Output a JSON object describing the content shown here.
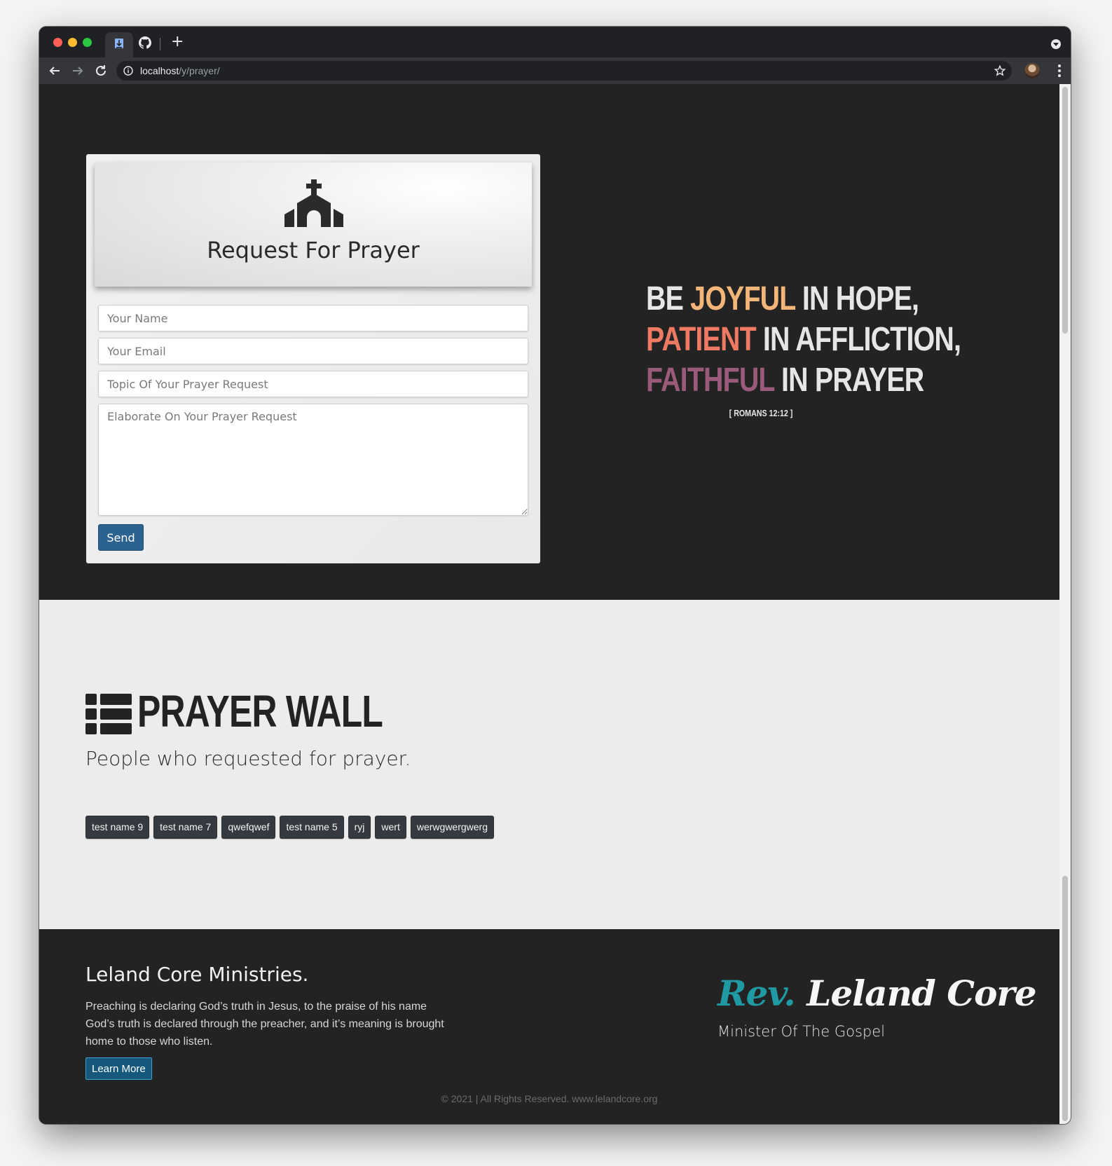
{
  "browser": {
    "url_host": "localhost",
    "url_path": "/y/prayer/",
    "new_tab_label": "+"
  },
  "form": {
    "title": "Request For Prayer",
    "name_placeholder": "Your Name",
    "email_placeholder": "Your Email",
    "topic_placeholder": "Topic Of Your Prayer Request",
    "message_placeholder": "Elaborate On Your Prayer Request",
    "send_label": "Send"
  },
  "verse": {
    "line1_pre": "BE ",
    "line1_hl": "JOYFUL",
    "line1_post": " IN HOPE,",
    "line2_hl": "PATIENT",
    "line2_post": " IN AFFLICTION,",
    "line3_hl": "FAITHFUL",
    "line3_post": " IN PRAYER",
    "reference": "[ ROMANS 12:12 ]",
    "colors": {
      "joyful": "#f4b579",
      "patient": "#ee7a64",
      "faithful": "#9a5b7a"
    }
  },
  "wall": {
    "title": "PRAYER WALL",
    "subtitle": "People who requested for prayer.",
    "names": [
      "test name 9",
      "test name 7",
      "qwefqwef",
      "test name 5",
      "ryj",
      "wert",
      "werwgwergwerg"
    ]
  },
  "footer": {
    "org_name": "Leland Core Ministries.",
    "description": "Preaching is declaring God’s truth in Jesus, to the praise of his name God’s truth is declared through the preacher, and it’s meaning is brought home to those who listen.",
    "learn_more_label": "Learn More",
    "signature_prefix": "Rev.",
    "signature_name": " Leland Core",
    "minister_title": "Minister Of The Gospel",
    "copyright": "© 2021 | All Rights Reserved. www.lelandcore.org"
  }
}
